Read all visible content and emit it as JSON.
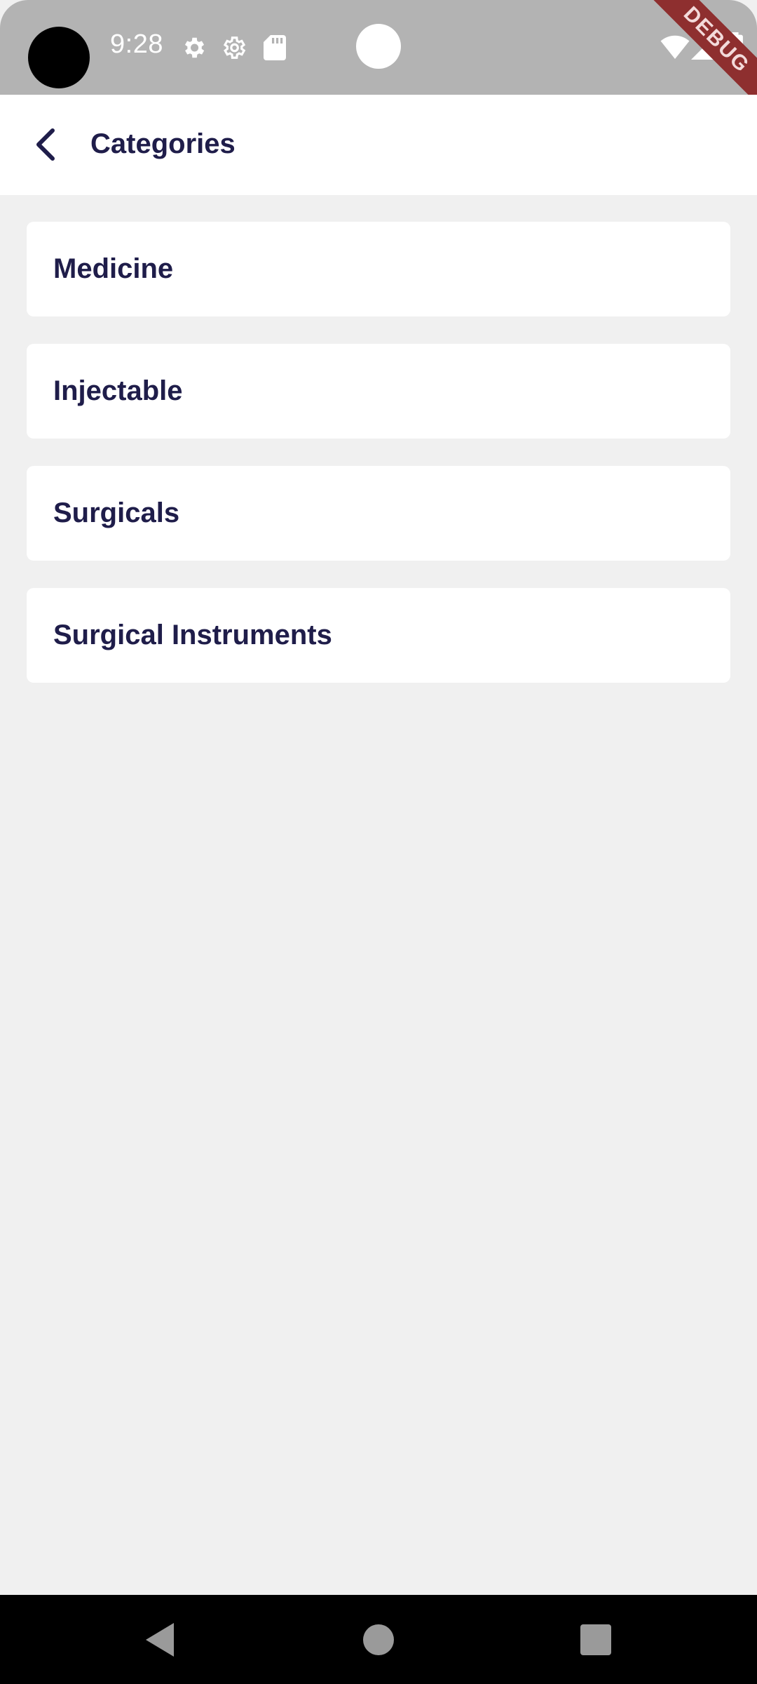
{
  "status_bar": {
    "time": "9:28",
    "debug_banner": "DEBUG",
    "icons": [
      "settings-icon",
      "settings-outline-icon",
      "sd-card-icon",
      "wifi-icon",
      "signal-icon",
      "battery-icon"
    ]
  },
  "app_bar": {
    "title": "Categories",
    "back_icon": "chevron-left-icon"
  },
  "categories": [
    {
      "label": "Medicine"
    },
    {
      "label": "Injectable"
    },
    {
      "label": "Surgicals"
    },
    {
      "label": "Surgical Instruments"
    }
  ],
  "nav_bar": {
    "icons": [
      "back-triangle-icon",
      "home-circle-icon",
      "recents-square-icon"
    ]
  },
  "colors": {
    "status_bar": "#b3b3b3",
    "app_bar": "#ffffff",
    "background": "#f0f0f0",
    "text_primary": "#1f1d4a",
    "debug_ribbon": "#8e2f2f",
    "nav_bar": "#000000"
  }
}
